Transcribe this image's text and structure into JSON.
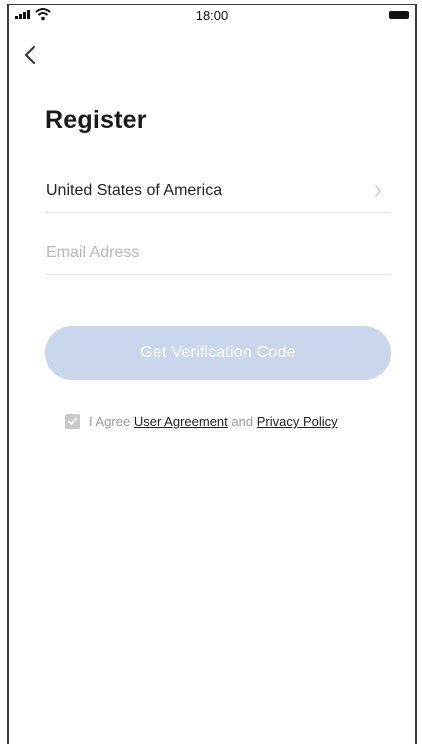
{
  "status_bar": {
    "time": "18:00"
  },
  "header": {
    "back_icon": "chevron-left-icon",
    "title": "Register"
  },
  "form": {
    "country": "United States of America",
    "country_chevron_icon": "chevron-right-icon",
    "email_placeholder": "Email Adress",
    "email_value": "",
    "submit_label": "Get Verification Code"
  },
  "agreement": {
    "checked": true,
    "prefix": "I Agree",
    "user_agreement_label": "User Agreement",
    "conjunction": "and",
    "privacy_policy_label": "Privacy Policy"
  },
  "colors": {
    "button_bg": "#c9d6eb",
    "checkbox": "#c9c9c9"
  }
}
